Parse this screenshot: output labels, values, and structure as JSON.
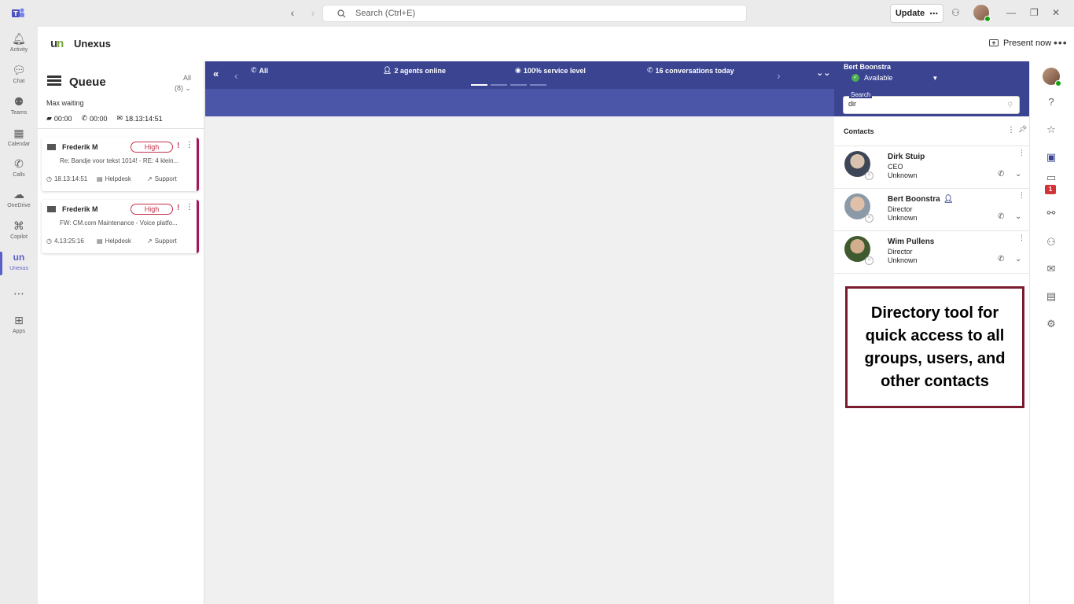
{
  "titlebar": {
    "search_placeholder": "Search (Ctrl+E)",
    "update_label": "Update",
    "update_more": "⋯"
  },
  "rail": [
    {
      "label": "Activity",
      "icon": "bell-icon"
    },
    {
      "label": "Chat",
      "icon": "chat-icon"
    },
    {
      "label": "Teams",
      "icon": "teams-icon"
    },
    {
      "label": "Calendar",
      "icon": "calendar-icon"
    },
    {
      "label": "Calls",
      "icon": "phone-icon"
    },
    {
      "label": "OneDrive",
      "icon": "cloud-icon"
    },
    {
      "label": "Copilot",
      "icon": "copilot-icon"
    },
    {
      "label": "Unexus",
      "icon": "unexus-icon"
    },
    {
      "label": "",
      "icon": "more-icon"
    },
    {
      "label": "Apps",
      "icon": "apps-icon"
    }
  ],
  "app": {
    "name": "Unexus",
    "present_now": "Present now"
  },
  "queue": {
    "title": "Queue",
    "filter": "All",
    "count": "(8)",
    "max_waiting_label": "Max waiting",
    "stats": {
      "chat": "00:00",
      "phone": "00:00",
      "email": "18.13:14:51"
    },
    "items": [
      {
        "from": "Frederik M",
        "priority": "High",
        "subject": "Re: Bandje voor tekst 1014! - RE: 4 klein...",
        "time": "18.13:14:51",
        "channel": "Helpdesk",
        "team": "Support"
      },
      {
        "from": "Frederik M",
        "priority": "High",
        "subject": "FW: CM.com Maintenance - Voice platfo...",
        "time": "4.13:25:16",
        "channel": "Helpdesk",
        "team": "Support"
      }
    ]
  },
  "topbar": {
    "all": "All",
    "agents": "2 agents online",
    "service": "100% service level",
    "conversations": "16 conversations today"
  },
  "directory": {
    "user": "Bert Boonstra",
    "status": "Available",
    "search_label": "Search",
    "search_value": "dir",
    "contacts_label": "Contacts",
    "contacts": [
      {
        "name": "Dirk Stuip",
        "role": "CEO",
        "status": "Unknown",
        "badge": false
      },
      {
        "name": "Bert Boonstra",
        "role": "Director",
        "status": "Unknown",
        "badge": true
      },
      {
        "name": "Wim Pullens",
        "role": "Director",
        "status": "Unknown",
        "badge": false
      }
    ]
  },
  "callout": {
    "text": "Directory tool for quick access to all groups, users, and other contacts"
  },
  "right_rail": {
    "badge": "1"
  },
  "colors": {
    "brand": "#3a4491",
    "accent": "#5b5fc7",
    "priority": "#c4314b",
    "callout_border": "#7a1a2e"
  }
}
